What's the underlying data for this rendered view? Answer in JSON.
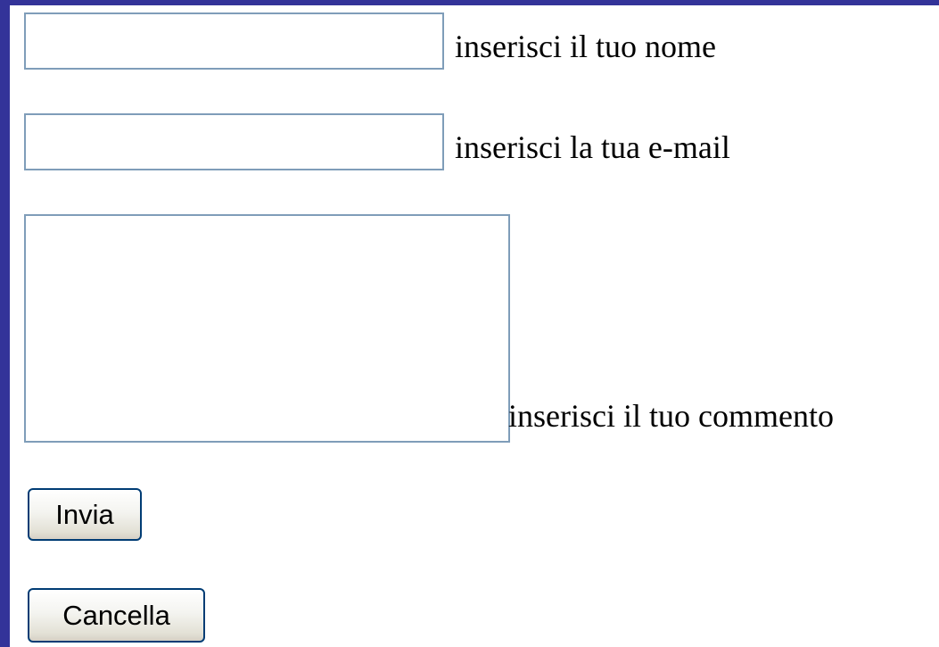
{
  "form": {
    "name": {
      "value": "",
      "label": "inserisci il tuo nome"
    },
    "email": {
      "value": "",
      "label": "inserisci la tua e-mail"
    },
    "comment": {
      "value": "",
      "label": "inserisci il tuo commento"
    },
    "buttons": {
      "submit_label": "Invia",
      "reset_label": "Cancella"
    }
  },
  "colors": {
    "frame": "#333399",
    "page_background": "#ffffff",
    "field_border": "#7f9db9",
    "button_border": "#003c74"
  }
}
